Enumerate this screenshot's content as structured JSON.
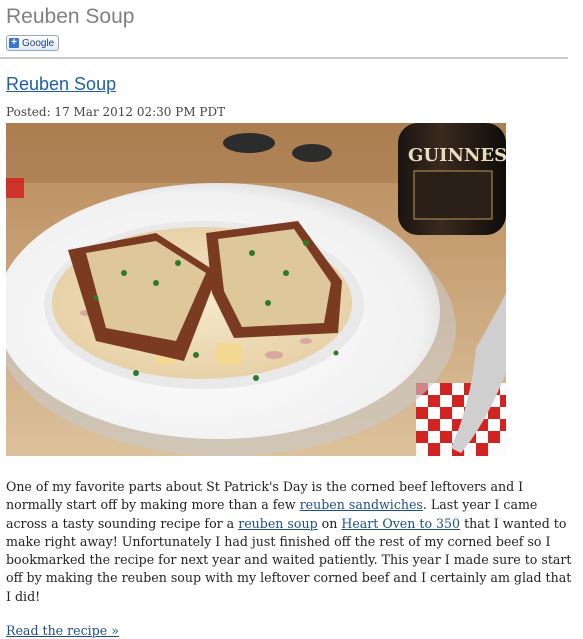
{
  "page": {
    "title": "Reuben Soup",
    "google_button_label": "Google"
  },
  "post": {
    "title": "Reuben Soup",
    "posted": "Posted: 17 Mar 2012 02:30 PM PDT",
    "image_alt": "Reuben soup bowl with cheesy rye toast and a Guinness bottle",
    "body": {
      "t1": "One of my favorite parts about St Patrick's Day is the corned beef leftovers and I normally start off by making more than a few ",
      "link1": "reuben sandwiches",
      "t2": ". Last year I came across a tasty sounding recipe for a ",
      "link2": "reuben soup",
      "t3": " on ",
      "link3": "Heart Oven to 350",
      "t4": " that I wanted to make right away! Unfortunately I had just finished off the rest of my corned beef so I bookmarked the recipe for next year and waited patiently. This year I made sure to start off by making the reuben soup with my leftover corned beef and I certainly am glad that I did!"
    },
    "read_more": "Read the recipe »"
  },
  "colors": {
    "link": "#1d4f8e",
    "title_gray": "#808080",
    "divider": "#c9c9c9"
  },
  "icons": [
    "plus-icon"
  ]
}
